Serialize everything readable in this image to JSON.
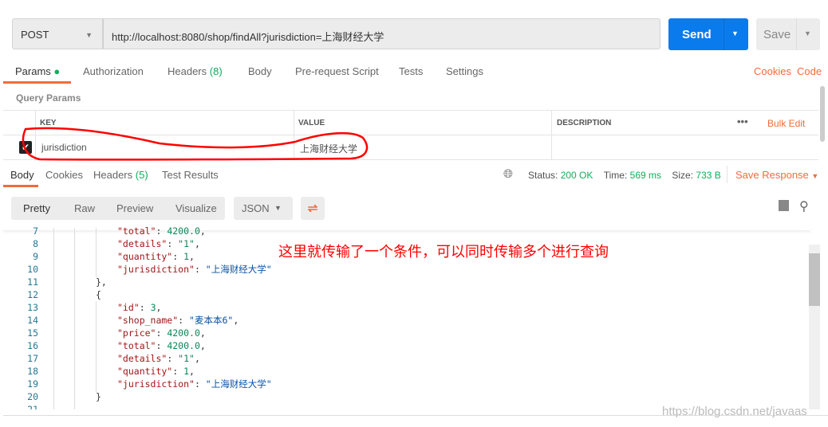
{
  "request": {
    "method": "POST",
    "url": "http://localhost:8080/shop/findAll?jurisdiction=上海财经大学",
    "send_label": "Send",
    "save_label": "Save"
  },
  "request_tabs": [
    {
      "label": "Params",
      "active": true
    },
    {
      "label": "Authorization"
    },
    {
      "label": "Headers",
      "count": "(8)"
    },
    {
      "label": "Body"
    },
    {
      "label": "Pre-request Script"
    },
    {
      "label": "Tests"
    },
    {
      "label": "Settings"
    }
  ],
  "links": {
    "cookies": "Cookies",
    "code": "Code"
  },
  "query_params": {
    "title": "Query Params",
    "columns": {
      "key": "KEY",
      "value": "VALUE",
      "description": "DESCRIPTION"
    },
    "bulk_edit": "Bulk Edit",
    "rows": [
      {
        "checked": true,
        "key": "jurisdiction",
        "value": "上海财经大学",
        "description": ""
      }
    ]
  },
  "response_tabs": [
    {
      "label": "Body",
      "active": true
    },
    {
      "label": "Cookies"
    },
    {
      "label": "Headers",
      "count": "(5)"
    },
    {
      "label": "Test Results"
    }
  ],
  "response_meta": {
    "status_label": "Status:",
    "status": "200 OK",
    "time_label": "Time:",
    "time": "569 ms",
    "size_label": "Size:",
    "size": "733 B",
    "save_response": "Save Response"
  },
  "view_modes": [
    "Pretty",
    "Raw",
    "Preview",
    "Visualize"
  ],
  "format": "JSON",
  "code_lines": [
    {
      "n": "7",
      "indent": 3,
      "k": "\"total\"",
      "v": "4200.0",
      "t": "n",
      "end": ","
    },
    {
      "n": "8",
      "indent": 3,
      "k": "\"details\"",
      "v": "\"1\"",
      "t": "n",
      "end": ","
    },
    {
      "n": "9",
      "indent": 3,
      "k": "\"quantity\"",
      "v": "1",
      "t": "n",
      "end": ","
    },
    {
      "n": "10",
      "indent": 3,
      "k": "\"jurisdiction\"",
      "v": "\"上海财经大学\"",
      "t": "s",
      "end": ""
    },
    {
      "n": "11",
      "indent": 2,
      "p": "},"
    },
    {
      "n": "12",
      "indent": 2,
      "p": "{"
    },
    {
      "n": "13",
      "indent": 3,
      "k": "\"id\"",
      "v": "3",
      "t": "n",
      "end": ","
    },
    {
      "n": "14",
      "indent": 3,
      "k": "\"shop_name\"",
      "v": "\"麦本本6\"",
      "t": "s",
      "end": ","
    },
    {
      "n": "15",
      "indent": 3,
      "k": "\"price\"",
      "v": "4200.0",
      "t": "n",
      "end": ","
    },
    {
      "n": "16",
      "indent": 3,
      "k": "\"total\"",
      "v": "4200.0",
      "t": "n",
      "end": ","
    },
    {
      "n": "17",
      "indent": 3,
      "k": "\"details\"",
      "v": "\"1\"",
      "t": "n",
      "end": ","
    },
    {
      "n": "18",
      "indent": 3,
      "k": "\"quantity\"",
      "v": "1",
      "t": "n",
      "end": ","
    },
    {
      "n": "19",
      "indent": 3,
      "k": "\"jurisdiction\"",
      "v": "\"上海财经大学\"",
      "t": "s",
      "end": ""
    },
    {
      "n": "20",
      "indent": 2,
      "p": "}"
    }
  ],
  "annotation": "这里就传输了一个条件，可以同时传输多个进行查询",
  "watermark": "https://blog.csdn.net/javaas",
  "colors": {
    "accent": "#f26b3a",
    "send": "#097bed",
    "success": "#0cb05c",
    "annotation": "#ff0000"
  }
}
